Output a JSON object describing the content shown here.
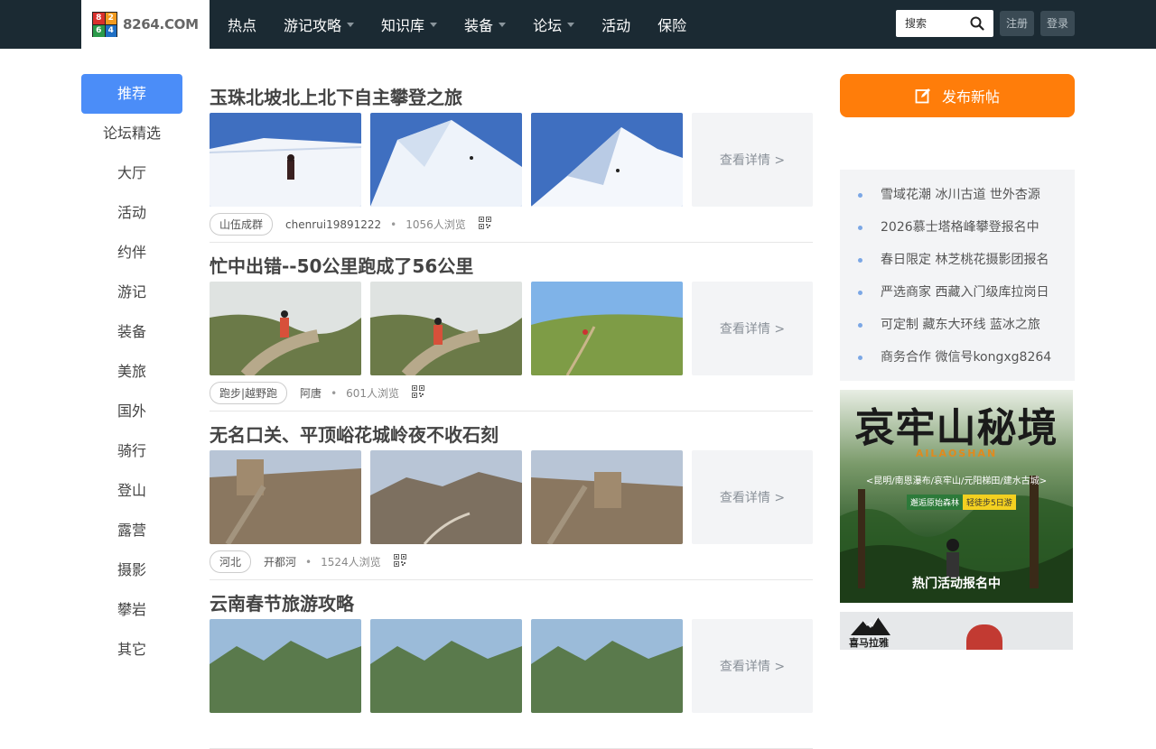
{
  "header": {
    "logo": {
      "text": "8264.COM",
      "mark": [
        "8",
        "2",
        "6",
        "4"
      ]
    },
    "nav": [
      {
        "label": "热点",
        "dropdown": false
      },
      {
        "label": "游记攻略",
        "dropdown": true
      },
      {
        "label": "知识库",
        "dropdown": true
      },
      {
        "label": "装备",
        "dropdown": true
      },
      {
        "label": "论坛",
        "dropdown": true
      },
      {
        "label": "活动",
        "dropdown": false
      },
      {
        "label": "保险",
        "dropdown": false
      }
    ],
    "search_placeholder": "搜索",
    "register_label": "注册",
    "login_label": "登录"
  },
  "sidebar": {
    "items": [
      {
        "label": "推荐",
        "active": true
      },
      {
        "label": "论坛精选",
        "active": false
      },
      {
        "label": "大厅",
        "active": false
      },
      {
        "label": "活动",
        "active": false
      },
      {
        "label": "约伴",
        "active": false
      },
      {
        "label": "游记",
        "active": false
      },
      {
        "label": "装备",
        "active": false
      },
      {
        "label": "美旅",
        "active": false
      },
      {
        "label": "国外",
        "active": false
      },
      {
        "label": "骑行",
        "active": false
      },
      {
        "label": "登山",
        "active": false
      },
      {
        "label": "露营",
        "active": false
      },
      {
        "label": "摄影",
        "active": false
      },
      {
        "label": "攀岩",
        "active": false
      },
      {
        "label": "其它",
        "active": false
      }
    ]
  },
  "feed": {
    "detail_label": "查看详情 >",
    "posts": [
      {
        "title": "玉珠北坡北上北下自主攀登之旅",
        "tag": "山伍成群",
        "author": "chenrui19891222",
        "views": "1056人浏览",
        "theme": "snow"
      },
      {
        "title": "忙中出错--50公里跑成了56公里",
        "tag": "跑步|越野跑",
        "author": "阿唐",
        "views": "601人浏览",
        "theme": "trail"
      },
      {
        "title": "无名口关、平顶峪花城岭夜不收石刻",
        "tag": "河北",
        "author": "开都河",
        "views": "1524人浏览",
        "theme": "wall"
      },
      {
        "title": "云南春节旅游攻略",
        "tag": "",
        "author": "",
        "views": "",
        "theme": "yunnan"
      }
    ]
  },
  "right": {
    "publish_label": "发布新帖",
    "promos": [
      "雪域花潮 冰川古道 世外杏源",
      "2026慕士塔格峰攀登报名中",
      "春日限定 林芝桃花摄影团报名",
      "严选商家 西藏入门级库拉岗日",
      "可定制 藏东大环线 蓝冰之旅",
      "商务合作 微信号kongxg8264"
    ],
    "ad1": {
      "headline": "哀牢山秘境",
      "english": "AILAOSHAN",
      "route": "<昆明/南恩瀑布/哀牢山/元阳梯田/建水古城>",
      "badge_left": "邂逅原始森林",
      "badge_right": "轻徒步5日游",
      "footer": "热门活动报名中"
    },
    "ad2": {
      "brand": "喜马拉雅"
    }
  },
  "colors": {
    "topbar": "#1b2a33",
    "accent_blue": "#4b8df8",
    "publish_orange": "#ff7d0a"
  }
}
